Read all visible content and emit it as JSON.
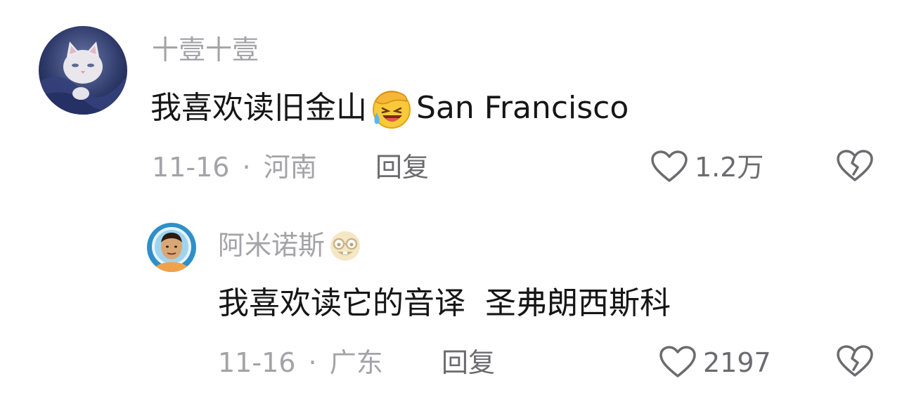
{
  "comments": [
    {
      "username": "十壹十壹",
      "text_before": "我喜欢读旧金山",
      "emoji": "laughing-crying-face",
      "text_after": "San Francisco",
      "date": "11-16",
      "separator": "·",
      "location": "河南",
      "reply_label": "回复",
      "likes": "1.2万",
      "avatar": "white-cat-photo"
    },
    {
      "username": "阿米诺斯",
      "username_emoji": "nerd-face",
      "text": "我喜欢读它的音译  圣弗朗西斯科",
      "date": "11-16",
      "separator": "·",
      "location": "广东",
      "reply_label": "回复",
      "likes": "2197",
      "avatar": "astronaut-man-photo"
    }
  ],
  "colors": {
    "meta_gray": "#a3a3a8",
    "action_gray": "#6b6b70",
    "text_black": "#161616"
  }
}
